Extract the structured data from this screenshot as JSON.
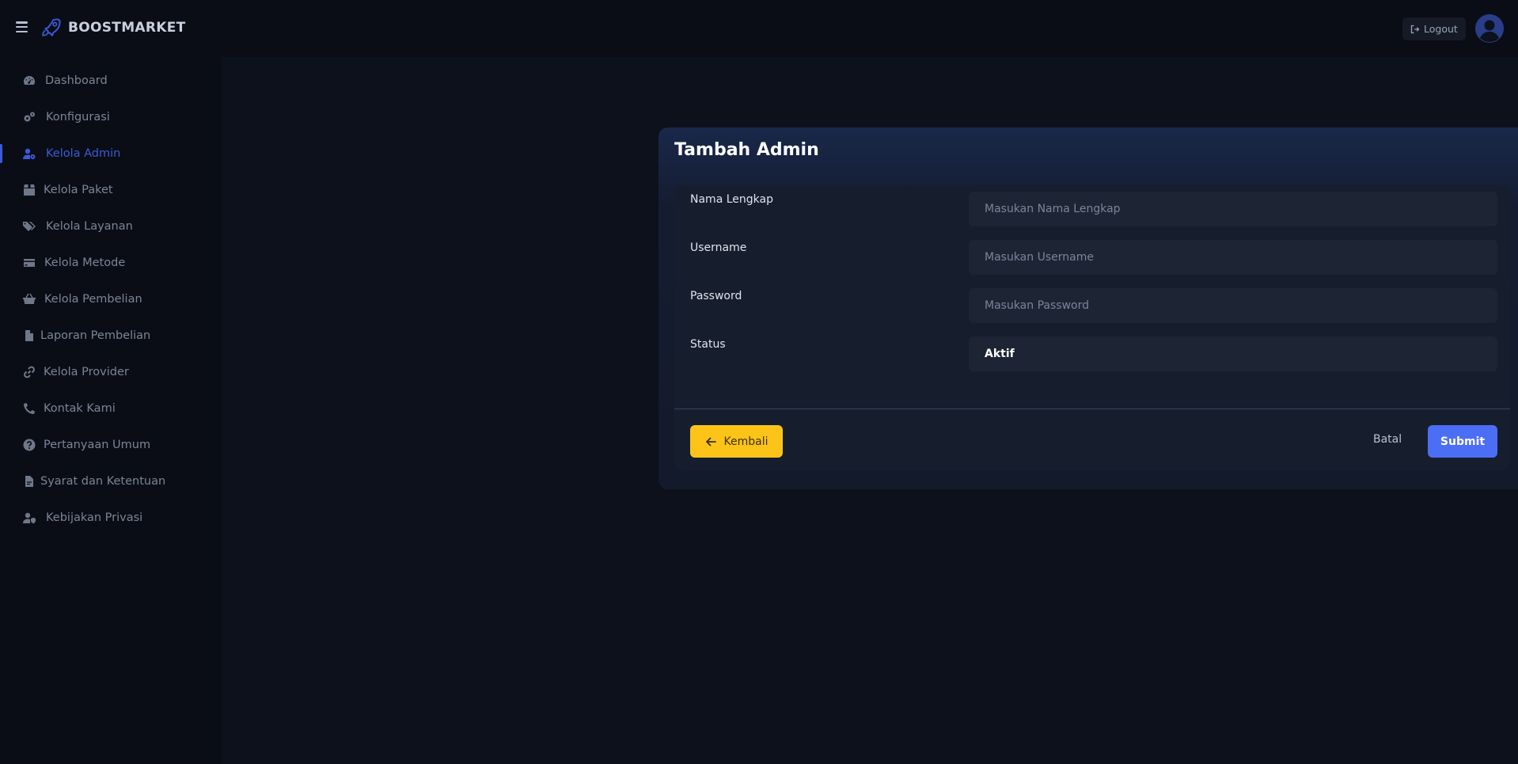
{
  "brand": {
    "name": "BOOSTMARKET",
    "logo_icon": "rocket-icon"
  },
  "header": {
    "logout_label": "Logout",
    "logout_icon": "logout-icon",
    "avatar_icon": "user-circle-icon"
  },
  "sidebar": {
    "items": [
      {
        "label": "Dashboard",
        "icon": "tachometer-icon"
      },
      {
        "label": "Konfigurasi",
        "icon": "cogs-icon"
      },
      {
        "label": "Kelola Admin",
        "icon": "user-cog-icon",
        "active": true
      },
      {
        "label": "Kelola Paket",
        "icon": "box-icon"
      },
      {
        "label": "Kelola Layanan",
        "icon": "tags-icon"
      },
      {
        "label": "Kelola Metode",
        "icon": "credit-card-icon"
      },
      {
        "label": "Kelola Pembelian",
        "icon": "shopping-basket-icon"
      },
      {
        "label": "Laporan Pembelian",
        "icon": "file-icon"
      },
      {
        "label": "Kelola Provider",
        "icon": "link-icon"
      },
      {
        "label": "Kontak Kami",
        "icon": "phone-icon"
      },
      {
        "label": "Pertanyaan Umum",
        "icon": "question-circle-icon"
      },
      {
        "label": "Syarat dan Ketentuan",
        "icon": "file-contract-icon"
      },
      {
        "label": "Kebijakan Privasi",
        "icon": "user-shield-icon"
      }
    ]
  },
  "form": {
    "title": "Tambah Admin",
    "fields": [
      {
        "label": "Nama Lengkap",
        "placeholder": "Masukan Nama Lengkap",
        "value": ""
      },
      {
        "label": "Username",
        "placeholder": "Masukan Username",
        "value": ""
      },
      {
        "label": "Password",
        "placeholder": "Masukan Password",
        "value": ""
      },
      {
        "label": "Status",
        "selected": "Aktif"
      }
    ],
    "back_label": "Kembali",
    "cancel_label": "Batal",
    "submit_label": "Submit"
  },
  "colors": {
    "accent": "#4c6ef5",
    "active_nav": "#3b5bd6",
    "back_button": "#fcc419"
  }
}
